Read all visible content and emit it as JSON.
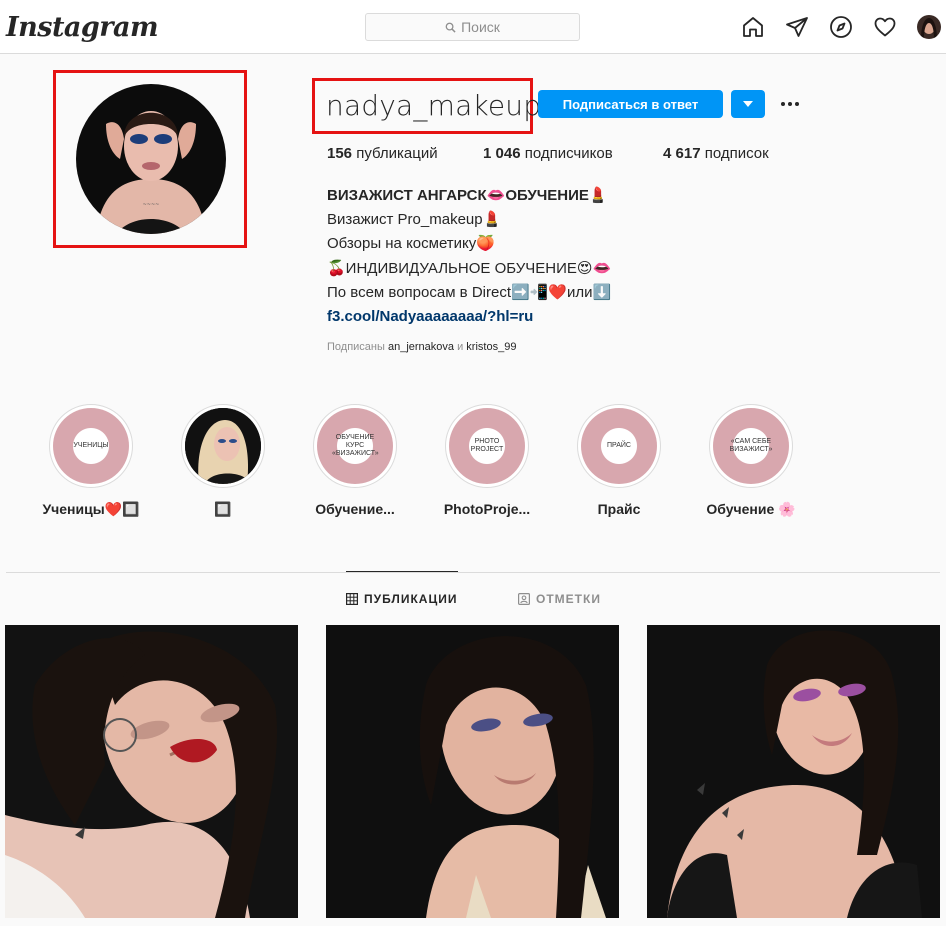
{
  "nav": {
    "logo": "Instagram",
    "search_placeholder": "Поиск",
    "icons": [
      "home-icon",
      "direct-icon",
      "explore-icon",
      "activity-icon",
      "profile-avatar"
    ]
  },
  "profile": {
    "username": "nadya_makeup6",
    "follow_button": "Подписаться в ответ",
    "stats": {
      "posts_count": "156",
      "posts_label": " публикаций",
      "followers_count": "1 046",
      "followers_label": " подписчиков",
      "following_count": "4 617",
      "following_label": " подписок"
    },
    "bio": {
      "name": "ВИЗАЖИСТ АНГАРСК👄ОБУЧЕНИЕ💄",
      "lines": [
        "Визажист Pro_makeup💄",
        "Обзоры на косметику🍑",
        "🍒ИНДИВИДУАЛЬНОЕ ОБУЧЕНИЕ😍👄",
        "По всем вопросам в Direct➡️📲❤️или⬇️"
      ],
      "link": "f3.cool/Nadyaaaaaaaa/?hl=ru"
    },
    "followed_by_prefix": "Подписаны ",
    "followed_by_1": "an_jernakova",
    "followed_by_sep": " и ",
    "followed_by_2": "kristos_99"
  },
  "highlights": [
    {
      "label": "Ученицы❤️🔲",
      "cover_text": "УЧЕНИЦЫ"
    },
    {
      "label": "🔲",
      "cover_text": ""
    },
    {
      "label": "Обучение...",
      "cover_text": "ОБУЧЕНИЕ КУРС «ВИЗАЖИСТ»"
    },
    {
      "label": "PhotoProje...",
      "cover_text": "PHOTO PROJECT"
    },
    {
      "label": "Прайс",
      "cover_text": "ПРАЙС"
    },
    {
      "label": "Обучение 🌸",
      "cover_text": "«САМ СЕБЕ ВИЗАЖИСТ»"
    }
  ],
  "tabs": {
    "posts": "ПУБЛИКАЦИИ",
    "tagged": "ОТМЕТКИ"
  },
  "colors": {
    "accent": "#0095f6",
    "annotation_red": "#e51212",
    "link": "#00376b"
  }
}
